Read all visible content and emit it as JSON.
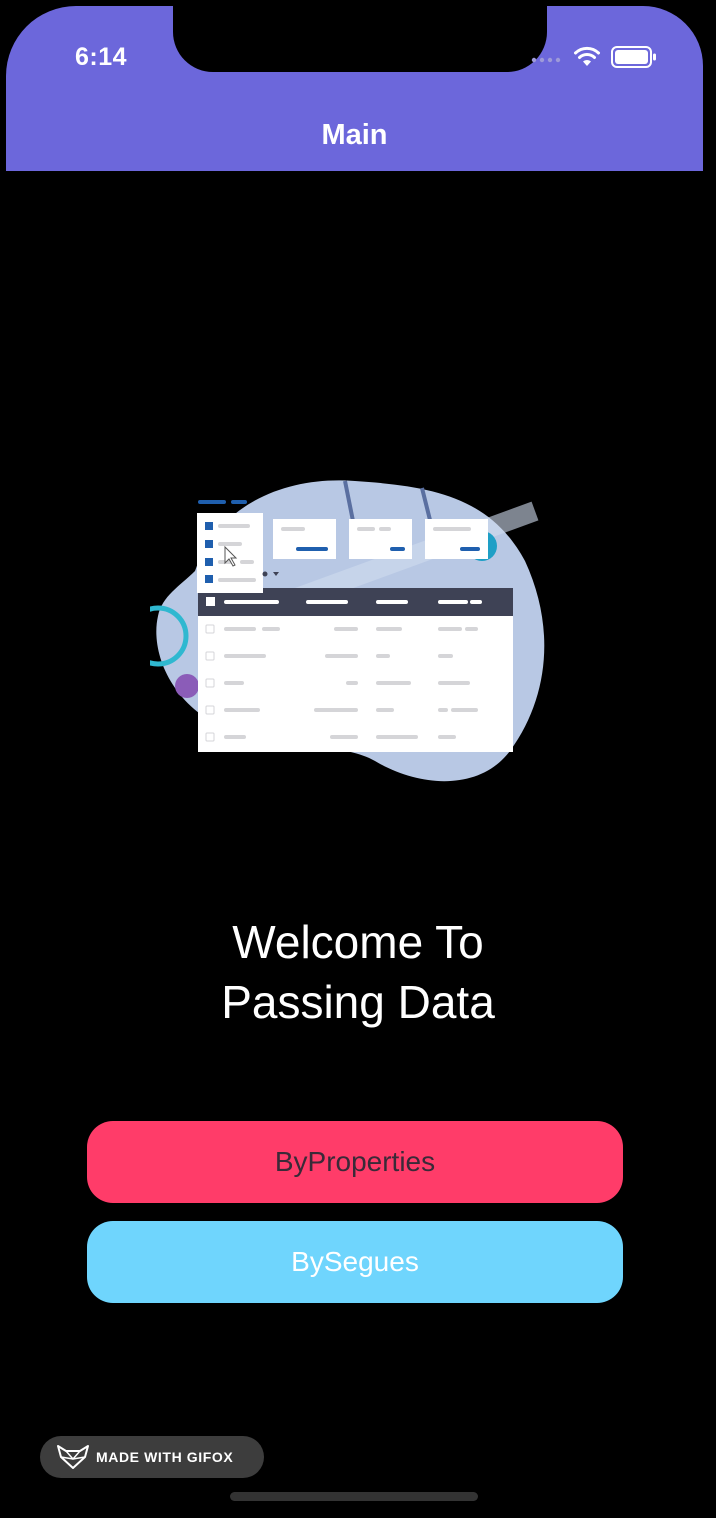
{
  "status_bar": {
    "time": "6:14"
  },
  "nav": {
    "title": "Main"
  },
  "welcome": {
    "line1": "Welcome To",
    "line2": "Passing Data"
  },
  "buttons": {
    "by_properties": "ByProperties",
    "by_segues": "BySegues"
  },
  "watermark": {
    "text": "MADE WITH GIFOX"
  },
  "colors": {
    "nav_background": "#6c67db",
    "by_properties_bg": "#ff3c69",
    "by_segues_bg": "#6fd5fd",
    "background": "#000000"
  },
  "icons": {
    "signal": "cellular-signal-icon",
    "wifi": "wifi-icon",
    "battery": "battery-icon",
    "gifox_logo": "fox-logo-icon"
  }
}
